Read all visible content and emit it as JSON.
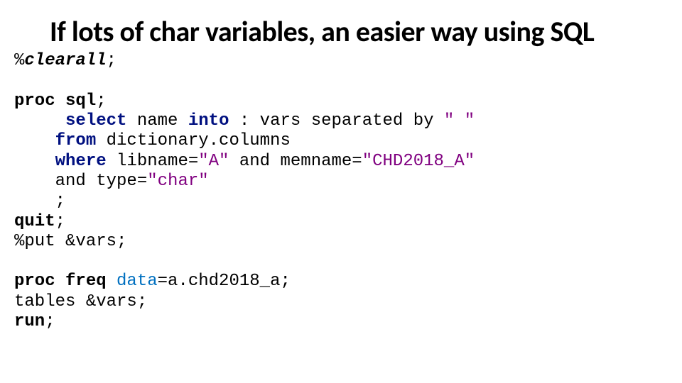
{
  "title": "If lots of char variables, an easier way using SQL",
  "code": {
    "l1_pct": "%",
    "l1_name": "clearall",
    "l1_sc": ";",
    "l2": "",
    "l3_proc": "proc",
    "l3_sql": "sql",
    "l3_sc": ";",
    "l4_indent": "     ",
    "l4_sel": "select",
    "l4_mid": " name ",
    "l4_into": "into",
    "l4_rest": " : vars separated by ",
    "l4_str": "\" \"",
    "l5_indent": "    ",
    "l5_from": "from",
    "l5_rest": " dictionary.columns",
    "l6_indent": "    ",
    "l6_where": "where",
    "l6_a": " libname=",
    "l6_s1": "\"A\"",
    "l6_b": " and memname=",
    "l6_s2": "\"CHD2018_A\"",
    "l7_indent": "    ",
    "l7_a": "and type=",
    "l7_s": "\"char\"",
    "l8_indent": "    ",
    "l8_sc": ";",
    "l9_quit": "quit",
    "l9_sc": ";",
    "l10": "%put &vars;",
    "l11": "",
    "l12_proc": "proc",
    "l12_freq": "freq",
    "l12_sp": " ",
    "l12_data": "data",
    "l12_rest": "=a.chd2018_a;",
    "l13": "tables &vars;",
    "l14_run": "run",
    "l14_sc": ";"
  }
}
